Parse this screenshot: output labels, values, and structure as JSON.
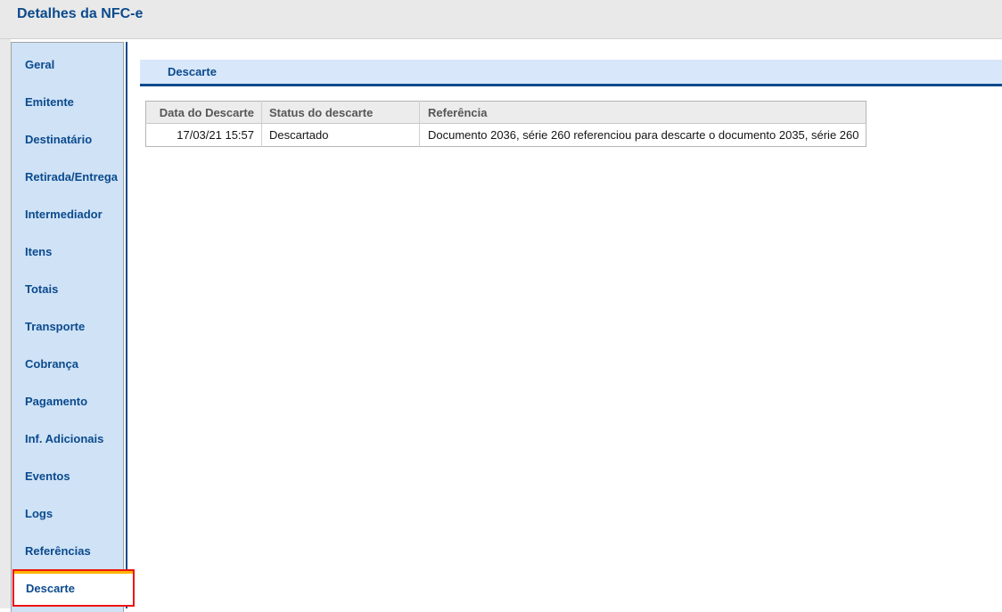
{
  "page": {
    "title": "Detalhes da NFC-e"
  },
  "sidebar": {
    "items": [
      {
        "id": "geral",
        "label": "Geral",
        "active": false
      },
      {
        "id": "emitente",
        "label": "Emitente",
        "active": false
      },
      {
        "id": "destinatario",
        "label": "Destinatário",
        "active": false
      },
      {
        "id": "retirada-entrega",
        "label": "Retirada/Entrega",
        "active": false
      },
      {
        "id": "intermediador",
        "label": "Intermediador",
        "active": false
      },
      {
        "id": "itens",
        "label": "Itens",
        "active": false
      },
      {
        "id": "totais",
        "label": "Totais",
        "active": false
      },
      {
        "id": "transporte",
        "label": "Transporte",
        "active": false
      },
      {
        "id": "cobranca",
        "label": "Cobrança",
        "active": false
      },
      {
        "id": "pagamento",
        "label": "Pagamento",
        "active": false
      },
      {
        "id": "inf-adicionais",
        "label": "Inf. Adicionais",
        "active": false
      },
      {
        "id": "eventos",
        "label": "Eventos",
        "active": false
      },
      {
        "id": "logs",
        "label": "Logs",
        "active": false
      },
      {
        "id": "referencias",
        "label": "Referências",
        "active": false
      },
      {
        "id": "descarte",
        "label": "Descarte",
        "active": true
      }
    ]
  },
  "section": {
    "title": "Descarte"
  },
  "table": {
    "columns": [
      "Data do Descarte",
      "Status do descarte",
      "Referência"
    ],
    "rows": [
      [
        "17/03/21 15:57",
        "Descartado",
        "Documento 2036, série 260 referenciou para descarte o documento 2035, série 260"
      ]
    ]
  },
  "colors": {
    "accent_navy": "#0b4a8d",
    "sidebar_bg": "#cfe2f6",
    "band_bg": "#d8e7fa",
    "topbar_bg": "#e9e9e9",
    "table_header_bg": "#ececec",
    "active_highlight_red": "#ee1414",
    "active_tab_orange": "#ffb400"
  }
}
